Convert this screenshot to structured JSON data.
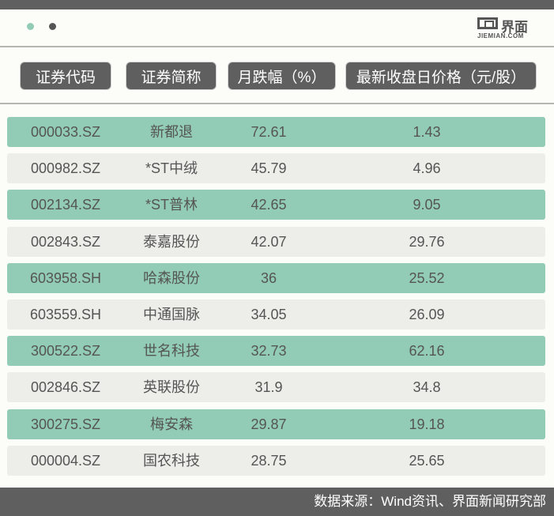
{
  "brand": {
    "logo_cn": "界面",
    "logo_en": "JIEMIAN.COM"
  },
  "colors": {
    "highlight": "#92cbb6",
    "plain": "#ededea",
    "dark": "#5f5f5f"
  },
  "headers": [
    "证券代码",
    "证券简称",
    "月跌幅（%）",
    "最新收盘日价格（元/股）"
  ],
  "rows": [
    {
      "code": "000033.SZ",
      "name": "新都退",
      "change": "72.61",
      "price": "1.43"
    },
    {
      "code": "000982.SZ",
      "name": "*ST中绒",
      "change": "45.79",
      "price": "4.96"
    },
    {
      "code": "002134.SZ",
      "name": "*ST普林",
      "change": "42.65",
      "price": "9.05"
    },
    {
      "code": "002843.SZ",
      "name": "泰嘉股份",
      "change": "42.07",
      "price": "29.76"
    },
    {
      "code": "603958.SH",
      "name": "哈森股份",
      "change": "36",
      "price": "25.52"
    },
    {
      "code": "603559.SH",
      "name": "中通国脉",
      "change": "34.05",
      "price": "26.09"
    },
    {
      "code": "300522.SZ",
      "name": "世名科技",
      "change": "32.73",
      "price": "62.16"
    },
    {
      "code": "002846.SZ",
      "name": "英联股份",
      "change": "31.9",
      "price": "34.8"
    },
    {
      "code": "300275.SZ",
      "name": "梅安森",
      "change": "29.87",
      "price": "19.18"
    },
    {
      "code": "000004.SZ",
      "name": "国农科技",
      "change": "28.75",
      "price": "25.65"
    }
  ],
  "footer": "数据来源：Wind资讯、界面新闻研究部"
}
